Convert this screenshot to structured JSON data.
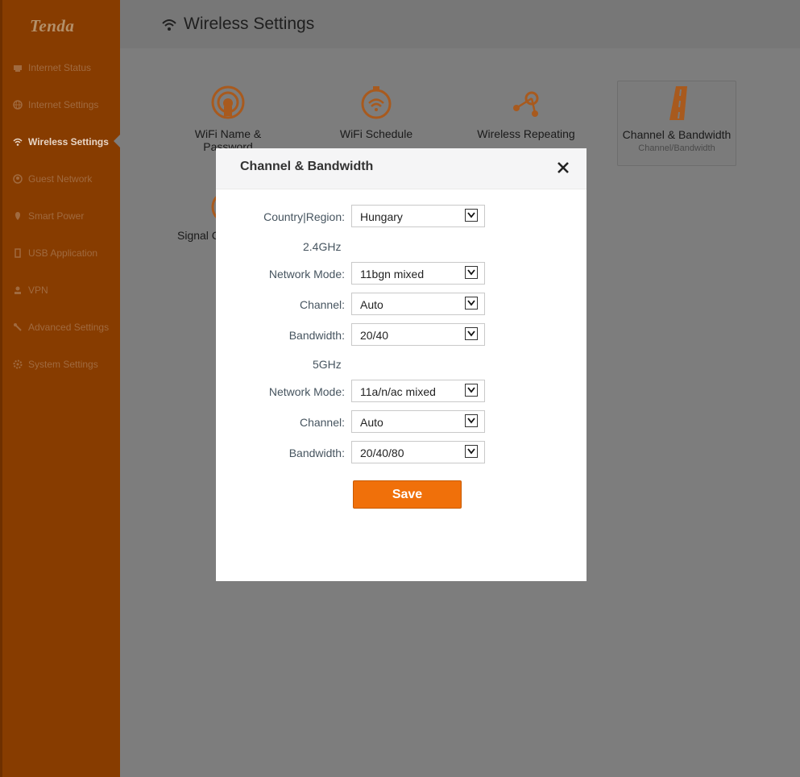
{
  "brand": {
    "logo_text": "Tenda",
    "accent": "#f0700a"
  },
  "sidebar": {
    "items": [
      {
        "label": "Internet Status",
        "icon": "dashboard-icon"
      },
      {
        "label": "Internet Settings",
        "icon": "globe-icon"
      },
      {
        "label": "Wireless Settings",
        "icon": "wifi-icon",
        "active": true
      },
      {
        "label": "Guest Network",
        "icon": "guest-icon"
      },
      {
        "label": "Smart Power",
        "icon": "power-icon"
      },
      {
        "label": "USB Application",
        "icon": "usb-icon"
      },
      {
        "label": "VPN",
        "icon": "vpn-icon"
      },
      {
        "label": "Advanced Settings",
        "icon": "wrench-icon"
      },
      {
        "label": "System Settings",
        "icon": "gear-icon"
      }
    ]
  },
  "header": {
    "title": "Wireless Settings"
  },
  "tiles": [
    {
      "label": "WiFi Name & Password",
      "icon": "wifi-name-icon"
    },
    {
      "label": "WiFi Schedule",
      "icon": "wifi-schedule-icon"
    },
    {
      "label": "Wireless Repeating",
      "icon": "repeating-icon"
    },
    {
      "label": "Channel & Bandwidth",
      "sublabel": "Channel/Bandwidth",
      "icon": "road-icon",
      "selected": true
    },
    {
      "label": "Signal C",
      "icon": "signal-icon"
    }
  ],
  "modal": {
    "title": "Channel & Bandwidth",
    "country": {
      "label": "Country|Region:",
      "value": "Hungary"
    },
    "band24": {
      "heading": "2.4GHz",
      "network_mode": {
        "label": "Network Mode:",
        "value": "11bgn mixed"
      },
      "channel": {
        "label": "Channel:",
        "value": "Auto"
      },
      "bandwidth": {
        "label": "Bandwidth:",
        "value": "20/40"
      }
    },
    "band5": {
      "heading": "5GHz",
      "network_mode": {
        "label": "Network Mode:",
        "value": "11a/n/ac mixed"
      },
      "channel": {
        "label": "Channel:",
        "value": "Auto"
      },
      "bandwidth": {
        "label": "Bandwidth:",
        "value": "20/40/80"
      }
    },
    "save_label": "Save"
  }
}
